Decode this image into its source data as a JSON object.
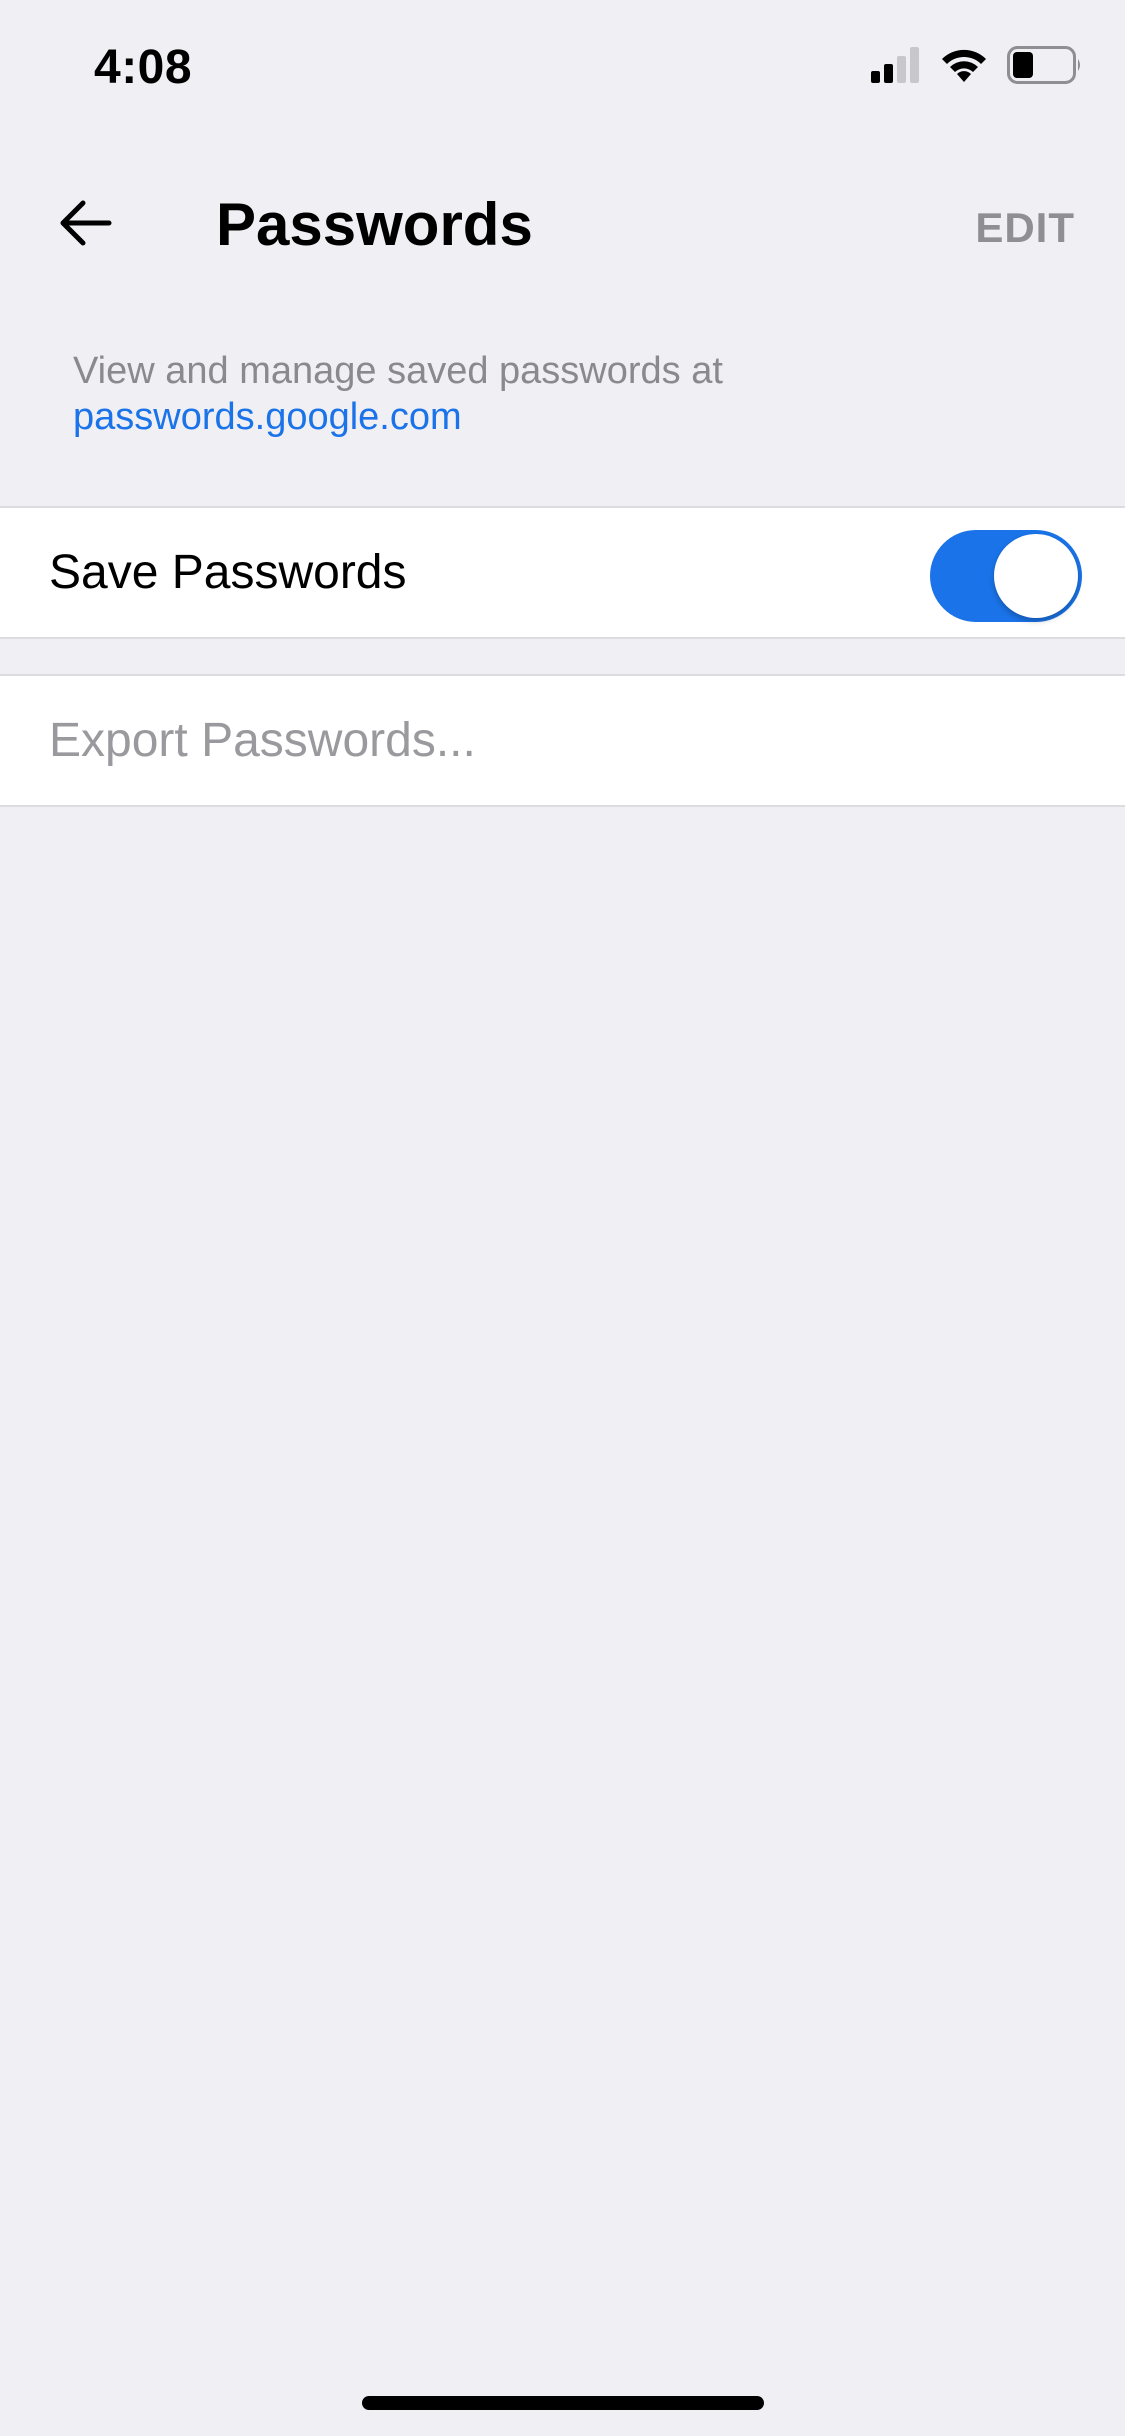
{
  "status_bar": {
    "time": "4:08",
    "icons": [
      "cellular-signal-icon",
      "wifi-icon",
      "battery-icon"
    ]
  },
  "nav": {
    "back_icon": "back-arrow-icon",
    "title": "Passwords",
    "edit_label": "EDIT"
  },
  "info": {
    "text": "View and manage saved passwords at",
    "link_text": "passwords.google.com"
  },
  "settings": {
    "save_passwords": {
      "label": "Save Passwords",
      "enabled": true
    },
    "export_passwords": {
      "label": "Export Passwords..."
    }
  },
  "colors": {
    "accent": "#1a73e8",
    "background": "#efeff4",
    "muted": "#8e8e93"
  }
}
